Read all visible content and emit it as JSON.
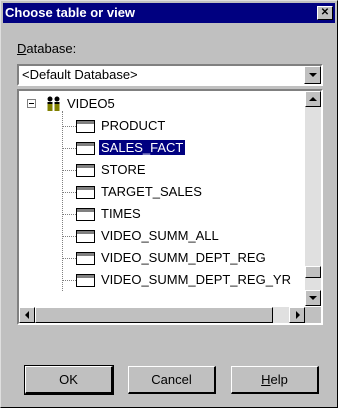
{
  "window": {
    "title": "Choose table or view",
    "close_glyph": "✕"
  },
  "database": {
    "label_prefix": "D",
    "label_rest": "atabase:",
    "selected": "<Default Database>"
  },
  "tree": {
    "root": {
      "label": "VIDEO5",
      "expander": "−",
      "icon": "database-users-icon"
    },
    "items": [
      {
        "label": "PRODUCT"
      },
      {
        "label": "SALES_FACT",
        "selected": true
      },
      {
        "label": "STORE"
      },
      {
        "label": "TARGET_SALES"
      },
      {
        "label": "TIMES"
      },
      {
        "label": "VIDEO_SUMM_ALL"
      },
      {
        "label": "VIDEO_SUMM_DEPT_REG"
      },
      {
        "label": "VIDEO_SUMM_DEPT_REG_YR"
      }
    ]
  },
  "buttons": {
    "ok": "OK",
    "cancel": "Cancel",
    "help_prefix": "H",
    "help_rest": "elp"
  },
  "colors": {
    "titlebar": "#000080",
    "face": "#c0c0c0",
    "selection": "#000080"
  }
}
